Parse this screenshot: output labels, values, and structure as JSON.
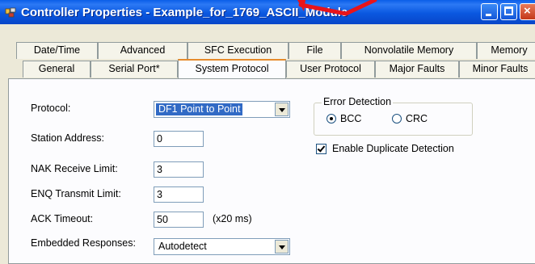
{
  "window": {
    "title": "Controller Properties - Example_for_1769_ASCII_Module",
    "buttons": {
      "minimize": "minimize",
      "maximize": "maximize",
      "close": "×"
    }
  },
  "tabs": {
    "back_row": [
      "Date/Time",
      "Advanced",
      "SFC Execution",
      "File",
      "Nonvolatile Memory",
      "Memory"
    ],
    "front_row": [
      "General",
      "Serial Port*",
      "System Protocol",
      "User Protocol",
      "Major Faults",
      "Minor Faults"
    ],
    "active": "System Protocol"
  },
  "form": {
    "protocol_label": "Protocol:",
    "protocol_value": "DF1 Point to Point",
    "station_label": "Station Address:",
    "station_value": "0",
    "nak_label": "NAK Receive Limit:",
    "nak_value": "3",
    "enq_label": "ENQ Transmit Limit:",
    "enq_value": "3",
    "ack_label": "ACK Timeout:",
    "ack_value": "50",
    "ack_unit": "(x20 ms)",
    "embedded_label": "Embedded Responses:",
    "embedded_value": "Autodetect"
  },
  "error_detection": {
    "title": "Error Detection",
    "options": [
      "BCC",
      "CRC"
    ],
    "selected": "BCC"
  },
  "duplicate_detection": {
    "label": "Enable Duplicate Detection",
    "checked": true
  },
  "colors": {
    "titlebar": "#0a58e0",
    "dialog": "#ece9d8",
    "active_tab_accent": "#e68b2c",
    "selection": "#316ac5",
    "annotation": "#e8141b"
  }
}
